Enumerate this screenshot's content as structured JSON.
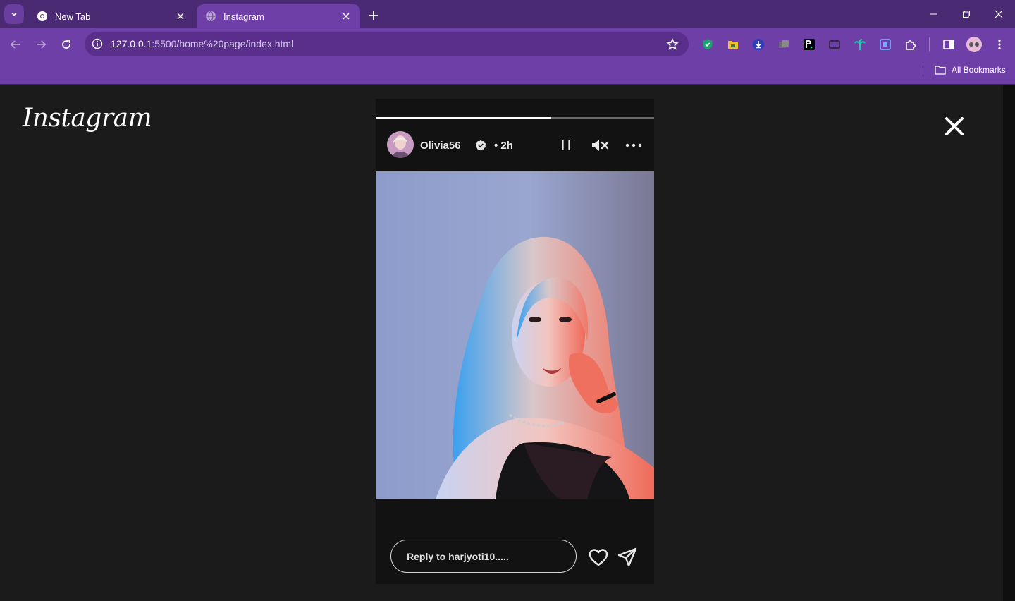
{
  "browser": {
    "tabs": [
      {
        "title": "New Tab",
        "active": false
      },
      {
        "title": "Instagram",
        "active": true
      }
    ],
    "url_host": "127.0.0.1",
    "url_rest": ":5500/home%20page/index.html",
    "bookmarks_label": "All Bookmarks"
  },
  "page": {
    "logo": "Instagram",
    "story": {
      "username": "Olivia56",
      "time": "• 2h",
      "progress": 0.63,
      "reply_placeholder": "Reply to harjyoti10....."
    }
  },
  "colors": {
    "tabbar": "#4a2a72",
    "toolbar": "#6f3fa8",
    "page_bg": "#1b1b1b",
    "story_bg": "#121212"
  }
}
